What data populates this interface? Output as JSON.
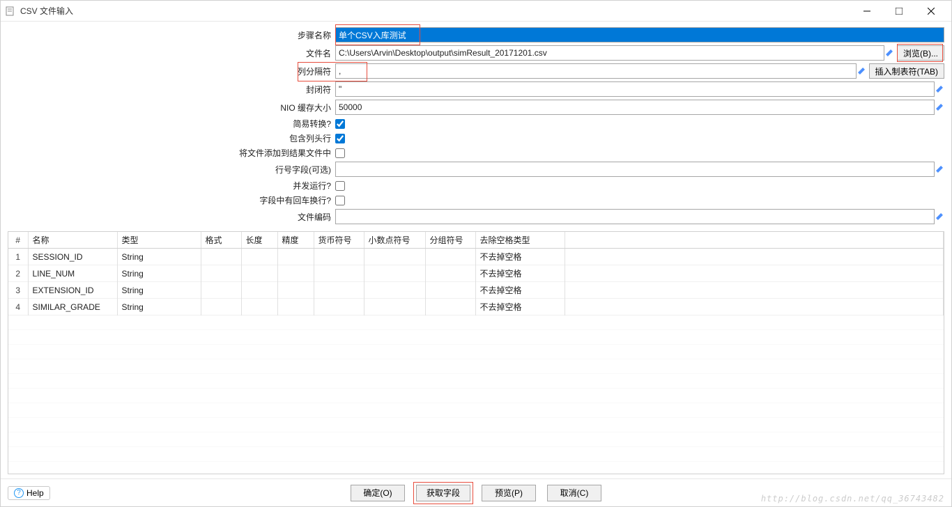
{
  "window": {
    "title": "CSV 文件输入"
  },
  "labels": {
    "step_name": "步骤名称",
    "file_name": "文件名",
    "delimiter": "列分隔符",
    "enclosure": "封闭符",
    "nio_buffer": "NIO 缓存大小",
    "simple_convert": "简易转换?",
    "include_header": "包含列头行",
    "add_to_result": "将文件添加到结果文件中",
    "row_num_field": "行号字段(可选)",
    "parallel_run": "并发运行?",
    "has_crlf": "字段中有回车换行?",
    "file_encoding": "文件编码"
  },
  "values": {
    "step_name": "单个CSV入库测试",
    "file_name": "C:\\Users\\Arvin\\Desktop\\output\\simResult_20171201.csv",
    "delimiter": ",",
    "enclosure": "\"",
    "nio_buffer": "50000",
    "simple_convert": true,
    "include_header": true,
    "add_to_result": false,
    "row_num_field": "",
    "parallel_run": false,
    "has_crlf": false,
    "file_encoding": ""
  },
  "side_buttons": {
    "browse": "浏览(B)...",
    "insert_tab": "插入制表符(TAB)"
  },
  "table": {
    "headers": {
      "idx": "#",
      "name": "名称",
      "type": "类型",
      "format": "格式",
      "length": "长度",
      "precision": "精度",
      "currency": "货币符号",
      "decimal": "小数点符号",
      "grouping": "分组符号",
      "trim": "去除空格类型"
    },
    "rows": [
      {
        "idx": "1",
        "name": "SESSION_ID",
        "type": "String",
        "format": "",
        "length": "",
        "precision": "",
        "currency": "",
        "decimal": "",
        "grouping": "",
        "trim": "不去掉空格"
      },
      {
        "idx": "2",
        "name": "LINE_NUM",
        "type": "String",
        "format": "",
        "length": "",
        "precision": "",
        "currency": "",
        "decimal": "",
        "grouping": "",
        "trim": "不去掉空格"
      },
      {
        "idx": "3",
        "name": "EXTENSION_ID",
        "type": "String",
        "format": "",
        "length": "",
        "precision": "",
        "currency": "",
        "decimal": "",
        "grouping": "",
        "trim": "不去掉空格"
      },
      {
        "idx": "4",
        "name": "SIMILAR_GRADE",
        "type": "String",
        "format": "",
        "length": "",
        "precision": "",
        "currency": "",
        "decimal": "",
        "grouping": "",
        "trim": "不去掉空格"
      }
    ]
  },
  "buttons": {
    "help": "Help",
    "ok": "确定(O)",
    "get_fields": "获取字段",
    "preview": "预览(P)",
    "cancel": "取消(C)"
  },
  "watermark": "http://blog.csdn.net/qq_36743482"
}
